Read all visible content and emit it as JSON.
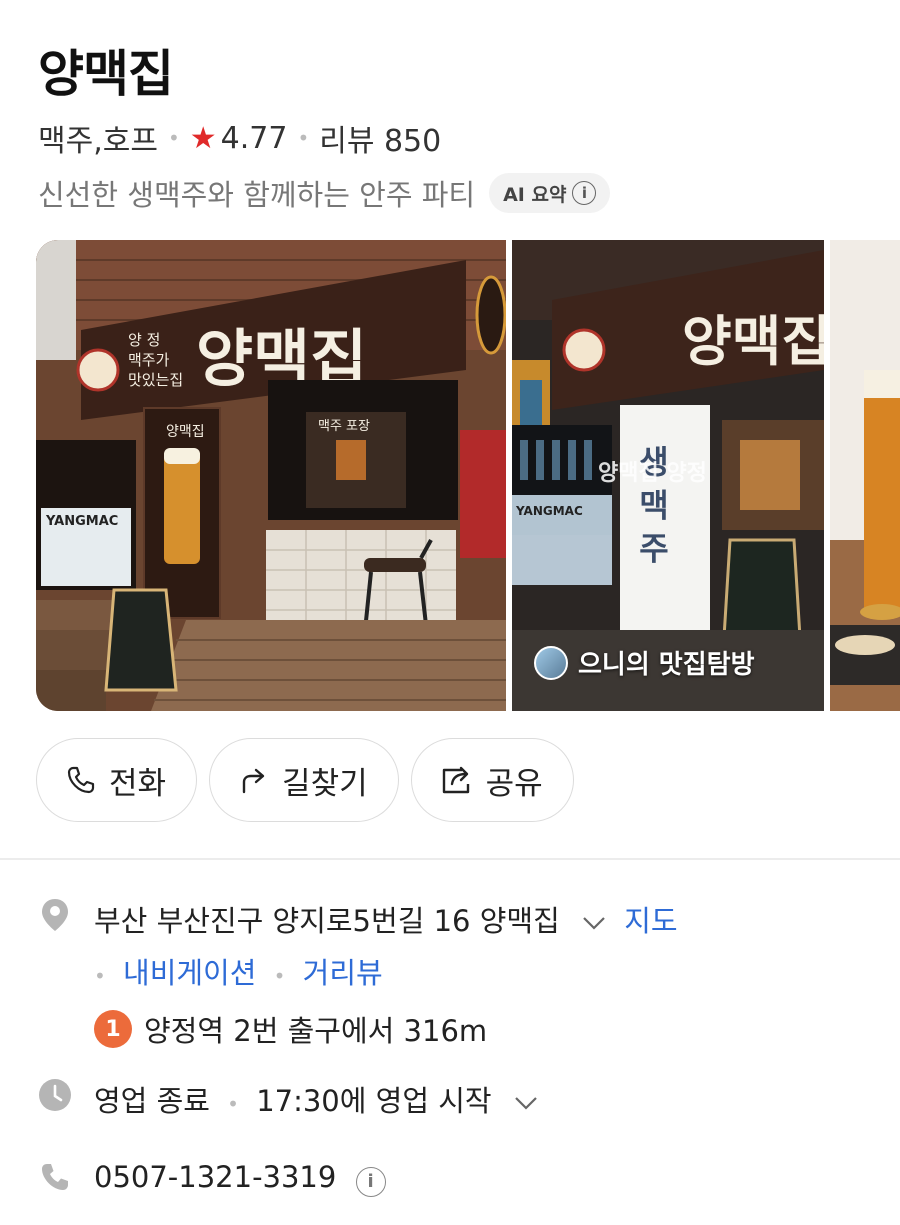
{
  "place": {
    "name": "양맥집",
    "category": "맥주,호프",
    "rating": "4.77",
    "review_label": "리뷰 850",
    "summary": "신선한 생맥주와 함께하는 안주 파티",
    "ai_chip": "AI 요약"
  },
  "photos": {
    "sign_main": "양맥집",
    "sign_sub_left": "양 정",
    "sign_sub_mid": "맥주가",
    "sign_sub_right": "맛있는집",
    "poster_label": "양맥집",
    "window_label": "맥주 포장",
    "side_sign": "YANGMAC",
    "overlay_text": "양맥집 양정",
    "credit": "으니의 맛집탐방",
    "vertical_sign": "생 맥 주"
  },
  "actions": [
    {
      "label": "전화",
      "icon": "phone-icon"
    },
    {
      "label": "길찾기",
      "icon": "directions-icon"
    },
    {
      "label": "공유",
      "icon": "share-icon"
    }
  ],
  "address": {
    "text": "부산 부산진구 양지로5번길 16 양맥집",
    "map_link": "지도",
    "navigation_link": "내비게이션",
    "streetview_link": "거리뷰",
    "station_number": "1",
    "station_text": "양정역 2번 출구에서 316m"
  },
  "hours": {
    "status": "영업 종료",
    "next": "17:30에 영업 시작"
  },
  "phone": {
    "number": "0507-1321-3319"
  },
  "colors": {
    "star": "#e02a2a",
    "link": "#2e6bd6",
    "subway_line1": "#ec6b3b"
  }
}
